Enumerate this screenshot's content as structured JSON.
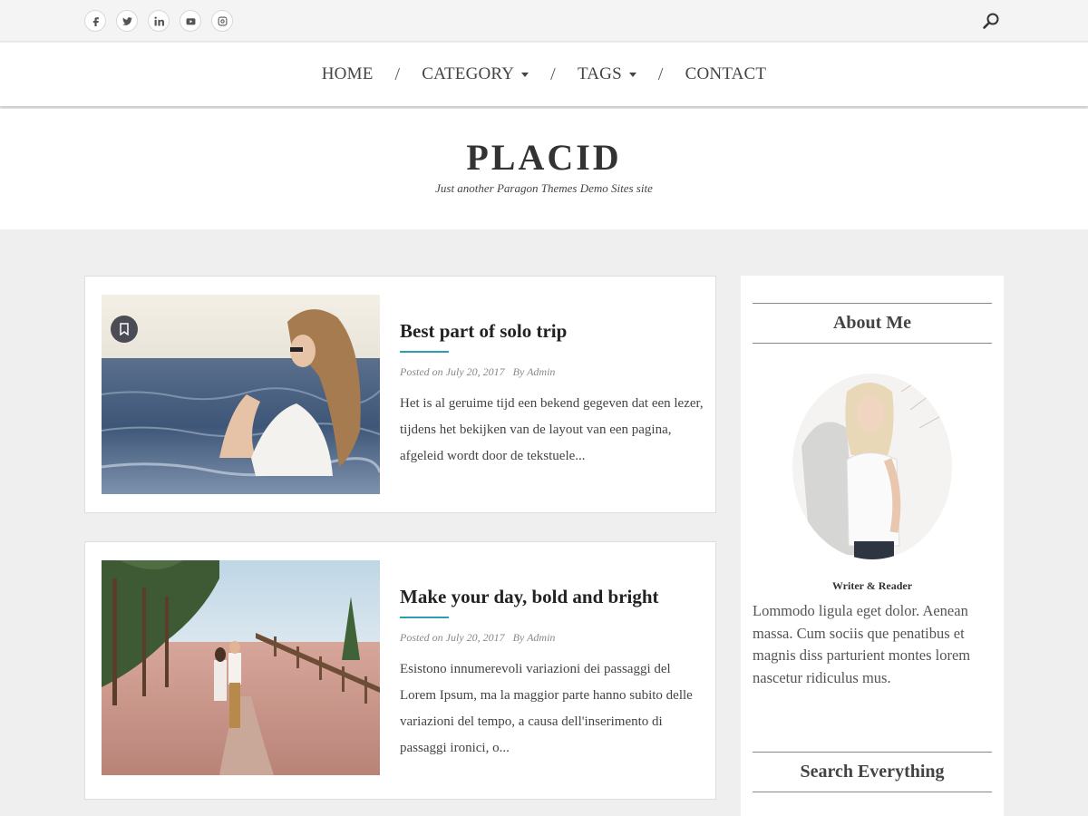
{
  "social": {
    "icons": [
      "facebook-icon",
      "twitter-icon",
      "linkedin-icon",
      "youtube-icon",
      "instagram-icon"
    ]
  },
  "nav": {
    "home": "HOME",
    "category": "CATEGORY",
    "tags": "TAGS",
    "contact": "CONTACT",
    "separator": "/"
  },
  "site": {
    "title": "PLACID",
    "tagline": "Just another Paragon Themes Demo Sites site"
  },
  "posts": [
    {
      "title": "Best part of solo trip",
      "date": "Posted on July 20, 2017",
      "author": "By Admin",
      "excerpt": "Het is al geruime tijd een bekend gegeven dat een lezer, tijdens het bekijken van de layout van een pagina, afgeleid wordt door de tekstuele..."
    },
    {
      "title": "Make your day, bold and bright",
      "date": "Posted on July 20, 2017",
      "author": "By Admin",
      "excerpt": "Esistono innumerevoli variazioni dei passaggi del Lorem Ipsum, ma la maggior parte hanno subito delle variazioni del tempo, a causa dell'inserimento di passaggi ironici, o..."
    }
  ],
  "sidebar": {
    "about_title": "About Me",
    "role": "Writer & Reader",
    "about_text": "Lommodo ligula eget dolor. Aenean massa. Cum sociis que penatibus et magnis diss parturient montes lorem nascetur ridiculus mus.",
    "search_title": "Search Everything"
  },
  "colors": {
    "accent": "#2c9fb0",
    "page_bg": "#efefef"
  }
}
